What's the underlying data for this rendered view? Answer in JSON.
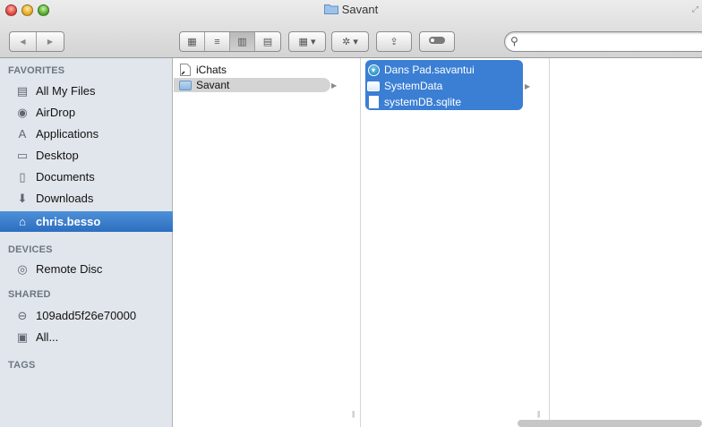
{
  "window": {
    "title": "Savant"
  },
  "toolbar": {
    "back_icon": "◀",
    "forward_icon": "▶",
    "view_icons": [
      "▦",
      "≡",
      "▥",
      "▤"
    ],
    "arrange_icon": "▦ ▾",
    "action_icon": "✲ ▾",
    "share_icon": "⇪",
    "tag_icon": "●",
    "search_placeholder": "",
    "search_value": ""
  },
  "sidebar": {
    "favorites_header": "FAVORITES",
    "favorites": [
      {
        "label": "All My Files",
        "icon": "all-my-files-icon",
        "glyph": "▤"
      },
      {
        "label": "AirDrop",
        "icon": "airdrop-icon",
        "glyph": "◉"
      },
      {
        "label": "Applications",
        "icon": "applications-icon",
        "glyph": "A"
      },
      {
        "label": "Desktop",
        "icon": "desktop-icon",
        "glyph": "▭"
      },
      {
        "label": "Documents",
        "icon": "documents-icon",
        "glyph": "▯"
      },
      {
        "label": "Downloads",
        "icon": "downloads-icon",
        "glyph": "⬇"
      },
      {
        "label": "chris.besso",
        "icon": "home-icon",
        "glyph": "⌂",
        "selected": true
      }
    ],
    "devices_header": "DEVICES",
    "devices": [
      {
        "label": "Remote Disc",
        "icon": "remote-disc-icon",
        "glyph": "◎"
      }
    ],
    "shared_header": "SHARED",
    "shared": [
      {
        "label": "109add5f26e70000",
        "icon": "network-drive-icon",
        "glyph": "⊖"
      },
      {
        "label": "All...",
        "icon": "network-computers-icon",
        "glyph": "▣"
      }
    ],
    "tags_header": "TAGS"
  },
  "columns": {
    "col1": [
      {
        "label": "iChats",
        "icon": "alias-file-icon",
        "kind": "file"
      },
      {
        "label": "Savant",
        "icon": "folder-icon",
        "kind": "folder",
        "selected": true
      }
    ],
    "col2": [
      {
        "label": "Dans Pad.savantui",
        "icon": "savant-app-icon",
        "kind": "app"
      },
      {
        "label": "SystemData",
        "icon": "folder-icon",
        "kind": "folder"
      },
      {
        "label": "systemDB.sqlite",
        "icon": "document-icon",
        "kind": "file"
      }
    ]
  },
  "colors": {
    "selection": "#3b7fd4",
    "sidebar_bg": "#e1e6ec",
    "sidebar_selected": "#2d6ebf"
  }
}
